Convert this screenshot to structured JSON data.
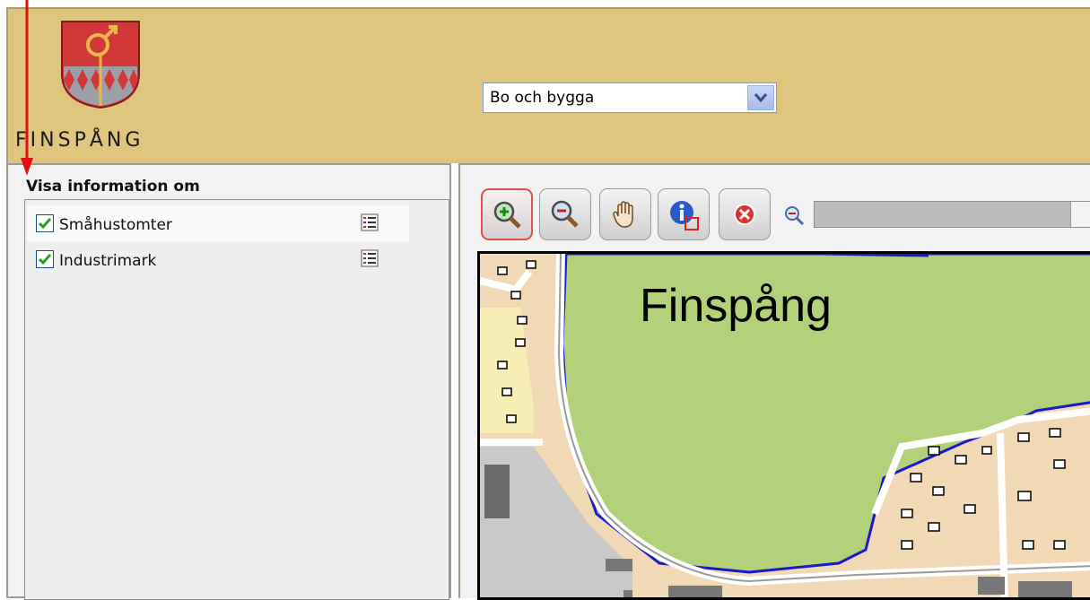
{
  "header": {
    "logo_text": "FINSPÅNG",
    "select_value": "Bo och bygga"
  },
  "left_panel": {
    "title": "Visa information om",
    "layers": [
      {
        "label": "Småhustomter",
        "checked": true
      },
      {
        "label": "Industrimark",
        "checked": true
      }
    ]
  },
  "toolbar": {
    "tools": [
      "zoom-in-icon",
      "zoom-out-icon",
      "pan-hand-icon",
      "info-icon",
      "clear-icon"
    ]
  },
  "map": {
    "label": "Finspång"
  },
  "colors": {
    "header_bg": "#dfc57d",
    "park": "#b3d07a",
    "residential": "#f2d9b6",
    "boundary": "#1a1acc",
    "arrow": "#e01010"
  }
}
